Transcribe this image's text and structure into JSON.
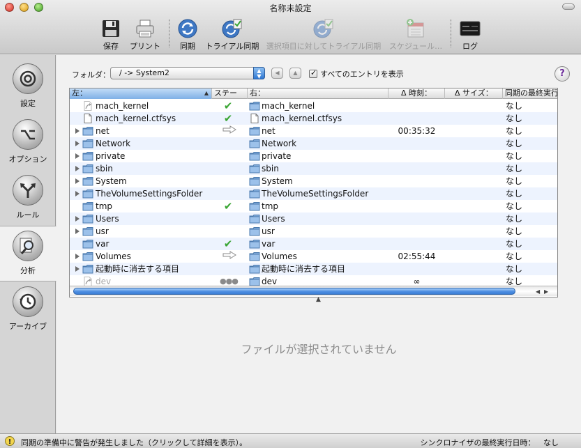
{
  "window": {
    "title": "名称未設定"
  },
  "toolbar": {
    "save": "保存",
    "print": "プリント",
    "sync": "同期",
    "trial_sync": "トライアル同期",
    "trial_sync_selected": "選択項目に対してトライアル同期",
    "schedule": "スケジュール…",
    "log": "ログ"
  },
  "sidebar": {
    "items": [
      {
        "label": "設定",
        "icon": "settings-icon",
        "active": false
      },
      {
        "label": "オプション",
        "icon": "option-key-icon",
        "active": false
      },
      {
        "label": "ルール",
        "icon": "fork-arrows-icon",
        "active": false
      },
      {
        "label": "分析",
        "icon": "magnifier-icon",
        "active": true
      },
      {
        "label": "アーカイブ",
        "icon": "history-clock-icon",
        "active": false
      }
    ]
  },
  "folder_bar": {
    "label": "フォルダ：",
    "selected": "/ -> System2",
    "show_all_label": "すべてのエントリを表示",
    "show_all_checked": true,
    "help": "?"
  },
  "table": {
    "columns": {
      "left": "左：",
      "status": "ステー",
      "right": "右：",
      "time": "Δ 時刻：",
      "size": "Δ サイズ：",
      "last_sync": "同期の最終実行"
    },
    "rows": [
      {
        "left": "mach_kernel",
        "kind": "file-alias",
        "status": "check",
        "right": "mach_kernel",
        "time": "",
        "size": "",
        "last_sync": "なし",
        "expand": false,
        "dim": false
      },
      {
        "left": "mach_kernel.ctfsys",
        "kind": "file",
        "status": "check",
        "right": "mach_kernel.ctfsys",
        "time": "",
        "size": "",
        "last_sync": "なし",
        "expand": false,
        "dim": false
      },
      {
        "left": "net",
        "kind": "folder",
        "status": "arrow",
        "right": "net",
        "time": "00:35:32",
        "size": "",
        "last_sync": "なし",
        "expand": true,
        "dim": false
      },
      {
        "left": "Network",
        "kind": "folder",
        "status": "",
        "right": "Network",
        "time": "",
        "size": "",
        "last_sync": "なし",
        "expand": true,
        "dim": false
      },
      {
        "left": "private",
        "kind": "folder",
        "status": "",
        "right": "private",
        "time": "",
        "size": "",
        "last_sync": "なし",
        "expand": true,
        "dim": false
      },
      {
        "left": "sbin",
        "kind": "folder",
        "status": "",
        "right": "sbin",
        "time": "",
        "size": "",
        "last_sync": "なし",
        "expand": true,
        "dim": false
      },
      {
        "left": "System",
        "kind": "folder",
        "status": "",
        "right": "System",
        "time": "",
        "size": "",
        "last_sync": "なし",
        "expand": true,
        "dim": false
      },
      {
        "left": "TheVolumeSettingsFolder",
        "kind": "folder",
        "status": "",
        "right": "TheVolumeSettingsFolder",
        "time": "",
        "size": "",
        "last_sync": "なし",
        "expand": true,
        "dim": false
      },
      {
        "left": "tmp",
        "kind": "folder",
        "status": "check",
        "right": "tmp",
        "time": "",
        "size": "",
        "last_sync": "なし",
        "expand": false,
        "dim": false
      },
      {
        "left": "Users",
        "kind": "folder",
        "status": "",
        "right": "Users",
        "time": "",
        "size": "",
        "last_sync": "なし",
        "expand": true,
        "dim": false
      },
      {
        "left": "usr",
        "kind": "folder",
        "status": "",
        "right": "usr",
        "time": "",
        "size": "",
        "last_sync": "なし",
        "expand": true,
        "dim": false
      },
      {
        "left": "var",
        "kind": "folder",
        "status": "check",
        "right": "var",
        "time": "",
        "size": "",
        "last_sync": "なし",
        "expand": false,
        "dim": false
      },
      {
        "left": "Volumes",
        "kind": "folder",
        "status": "arrow",
        "right": "Volumes",
        "time": "02:55:44",
        "size": "",
        "last_sync": "なし",
        "expand": true,
        "dim": false
      },
      {
        "left": "起動時に消去する項目",
        "kind": "folder",
        "status": "",
        "right": "起動時に消去する項目",
        "time": "",
        "size": "",
        "last_sync": "なし",
        "expand": true,
        "dim": false
      },
      {
        "left": "dev",
        "kind": "file-alias",
        "status": "dots",
        "right": "dev",
        "time": "∞",
        "size": "",
        "last_sync": "なし",
        "expand": false,
        "dim": true
      }
    ]
  },
  "detail": {
    "empty_message": "ファイルが選択されていません"
  },
  "statusbar": {
    "message": "同期の準備中に警告が発生しました（クリックして詳細を表示）。",
    "last_sync_label": "シンクロナイザの最終実行日時：",
    "last_sync_value": "なし"
  },
  "colors": {
    "accent": "#3b7fd7",
    "check": "#39a533",
    "selected_header": "#7fb0e6"
  }
}
